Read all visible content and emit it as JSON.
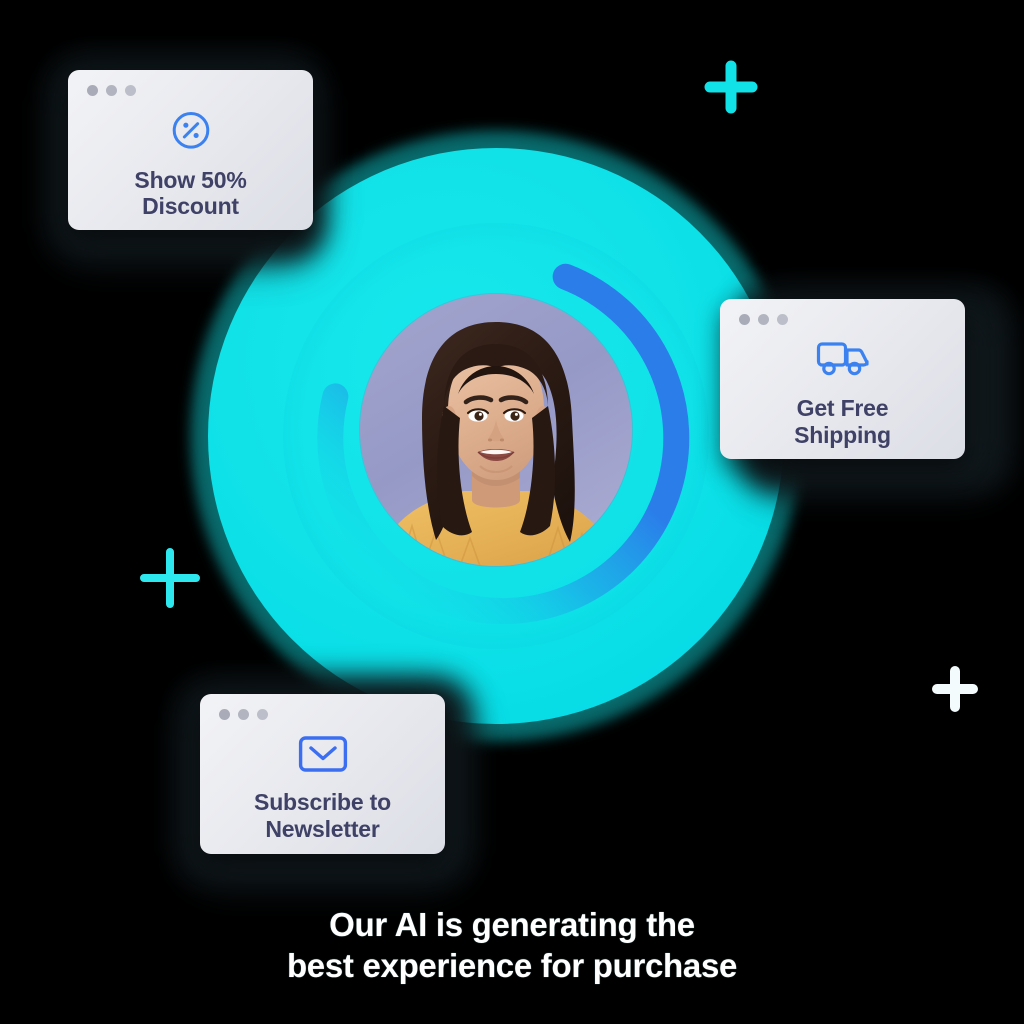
{
  "scene": {
    "background_color": "#000000",
    "accent_cyan": "#11e2e8",
    "accent_blue": "#2b7dea",
    "card_text_color": "#3f4266",
    "caption_color": "#ffffff"
  },
  "avatar": {
    "name": "customer-avatar",
    "alt": "Smiling woman with long dark brown hair wearing a mustard yellow knit sweater",
    "background_color": "#9b9fc9",
    "hair_color": "#2e1d17",
    "sweater_color": "#e8b košile"
  },
  "progress_ring": {
    "name": "ai-progress-ring",
    "track_color": "#11e2e8",
    "arc_color": "#2b7dea",
    "arc_percent": 62
  },
  "cards": [
    {
      "id": "discount",
      "icon": "percent-badge-icon",
      "label": "Show 50%\nDiscount",
      "icon_color": "#3b82f0"
    },
    {
      "id": "shipping",
      "icon": "delivery-truck-icon",
      "label": "Get Free\nShipping",
      "icon_color": "#3b82f0"
    },
    {
      "id": "newsletter",
      "icon": "envelope-icon",
      "label": "Subscribe to\nNewsletter",
      "icon_color": "#3b6ef0"
    }
  ],
  "decorations": [
    {
      "id": "plus-top-right",
      "shape": "plus-icon",
      "color": "#11e2e8"
    },
    {
      "id": "plus-left",
      "shape": "plus-icon",
      "color": "#2ee8f0"
    },
    {
      "id": "plus-bottom-right",
      "shape": "plus-icon",
      "color": "#f4fbfc"
    }
  ],
  "caption": {
    "text": "Our AI is generating the\nbest experience for purchase"
  }
}
